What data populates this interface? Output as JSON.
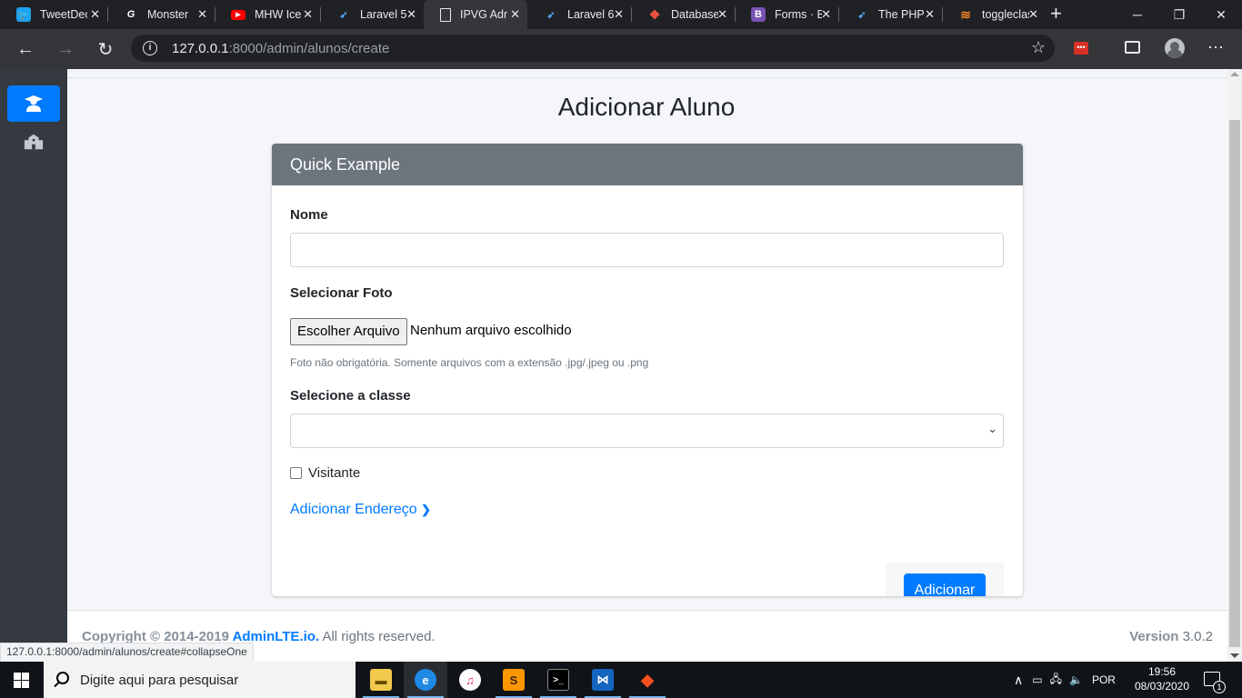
{
  "browser": {
    "tabs": [
      {
        "title": "TweetDeck",
        "favicon": "twitter-icon",
        "color": "#1da1f2"
      },
      {
        "title": "Monster",
        "favicon": "gamepedia-icon",
        "color": "#ffffff"
      },
      {
        "title": "MHW Ice",
        "favicon": "youtube-icon",
        "color": "#ff0000"
      },
      {
        "title": "Laravel 5",
        "favicon": "laracasts-icon",
        "color": "#4fa4f5"
      },
      {
        "title": "IPVG Adm",
        "favicon": "page-icon",
        "color": "#e8eaed",
        "active": true
      },
      {
        "title": "Laravel 6",
        "favicon": "laracasts-icon",
        "color": "#4fa4f5"
      },
      {
        "title": "Database",
        "favicon": "laravel-icon",
        "color": "#f05340"
      },
      {
        "title": "Forms · B",
        "favicon": "bootstrap-icon",
        "color": "#7952b3"
      },
      {
        "title": "The PHP",
        "favicon": "laracasts-icon",
        "color": "#4fa4f5"
      },
      {
        "title": "toggleclas",
        "favicon": "stackoverflow-icon",
        "color": "#f48024"
      }
    ],
    "url_host": "127.0.0.1",
    "url_rest": ":8000/admin/alunos/create",
    "status_url": "127.0.0.1:8000/admin/alunos/create#collapseOne"
  },
  "page": {
    "title": "Adicionar Aluno",
    "card_title": "Quick Example",
    "nome_label": "Nome",
    "nome_value": "",
    "foto_label": "Selecionar Foto",
    "file_button": "Escolher Arquivo",
    "file_status": "Nenhum arquivo escolhido",
    "foto_help": "Foto não obrigatória. Somente arquivos com a extensão .jpg/.jpeg ou .png",
    "classe_label": "Selecione a classe",
    "classe_value": "",
    "visitante_label": "Visitante",
    "visitante_checked": false,
    "endereco_link": "Adicionar Endereço",
    "submit_label": "Adicionar"
  },
  "footer": {
    "copyright_prefix": "Copyright © 2014-2019 ",
    "brand": "AdminLTE.io.",
    "rights": " All rights reserved.",
    "version_label": "Version",
    "version_value": "3.0.2"
  },
  "taskbar": {
    "search_placeholder": "Digite aqui para pesquisar",
    "language": "POR",
    "time": "19:56",
    "date": "08/03/2020",
    "notifications": "1"
  },
  "colors": {
    "primary": "#007bff",
    "sidebar": "#343a40",
    "card_header": "#6c757d"
  }
}
